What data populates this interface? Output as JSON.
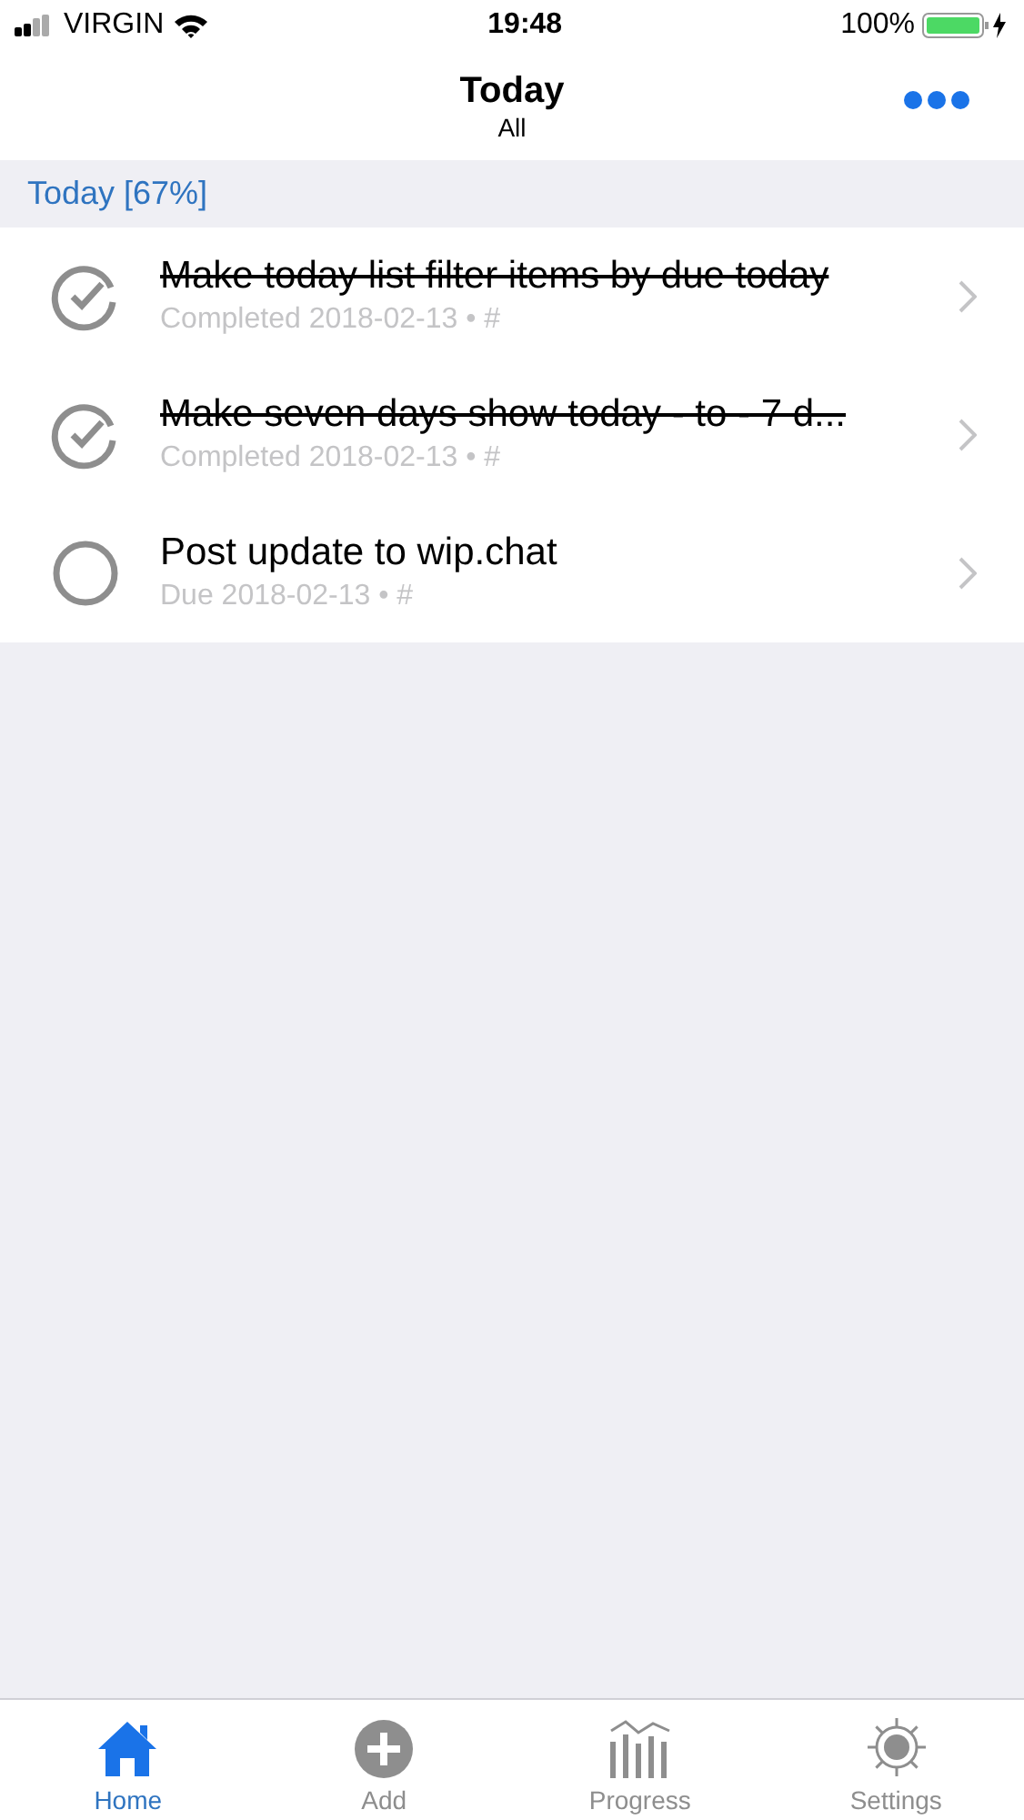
{
  "status_bar": {
    "carrier": "VIRGIN",
    "time": "19:48",
    "battery": "100%"
  },
  "nav": {
    "title": "Today",
    "subtitle": "All"
  },
  "section": {
    "title": "Today [67%]"
  },
  "tasks": [
    {
      "title": "Make today list filter items by due today",
      "meta": "Completed 2018-02-13 • #",
      "completed": true
    },
    {
      "title": "Make seven days show today - to - 7 d...",
      "meta": "Completed 2018-02-13 • #",
      "completed": true
    },
    {
      "title": "Post update to wip.chat",
      "meta": "Due 2018-02-13 • #",
      "completed": false
    }
  ],
  "tab_bar": [
    {
      "kind": "home",
      "label": "Home",
      "selected": true
    },
    {
      "kind": "add",
      "label": "Add",
      "selected": false
    },
    {
      "kind": "progress",
      "label": "Progress",
      "selected": false
    },
    {
      "kind": "settings",
      "label": "Settings",
      "selected": false
    }
  ]
}
